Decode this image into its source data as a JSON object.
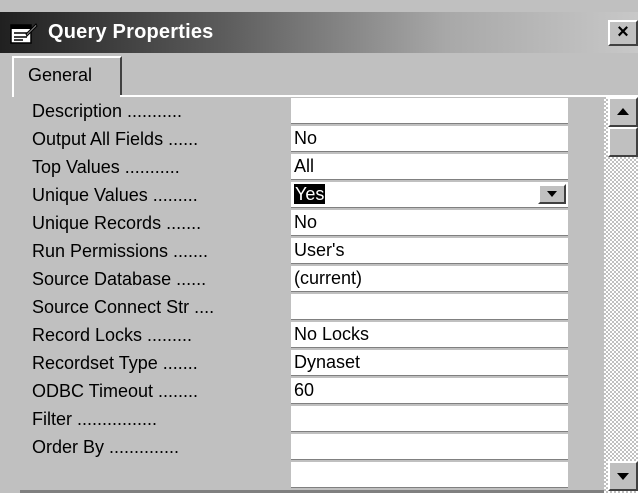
{
  "window": {
    "title": "Query Properties",
    "close_glyph": "×",
    "icon": "properties-sheet-icon"
  },
  "tabs": [
    {
      "label": "General",
      "selected": true
    }
  ],
  "properties": [
    {
      "label": "Description ...........",
      "value": ""
    },
    {
      "label": "Output All Fields ......",
      "value": "No"
    },
    {
      "label": "Top Values ...........",
      "value": "All"
    },
    {
      "label": "Unique Values .........",
      "value": "Yes",
      "dropdown": true,
      "selected": true
    },
    {
      "label": "Unique Records .......",
      "value": "No"
    },
    {
      "label": "Run Permissions .......",
      "value": "User's"
    },
    {
      "label": "Source Database ......",
      "value": "(current)"
    },
    {
      "label": "Source Connect Str ....",
      "value": ""
    },
    {
      "label": "Record Locks .........",
      "value": "No Locks"
    },
    {
      "label": "Recordset Type .......",
      "value": "Dynaset"
    },
    {
      "label": "ODBC Timeout ........",
      "value": "60"
    },
    {
      "label": "Filter ................",
      "value": ""
    },
    {
      "label": "Order By ..............",
      "value": ""
    },
    {
      "label": "",
      "value": ""
    }
  ],
  "scrollbar": {
    "up_icon": "scroll-up-arrow-icon",
    "down_icon": "scroll-down-arrow-icon"
  },
  "colors": {
    "titlebar_start": "#202020",
    "titlebar_end": "#c8c8c8",
    "face": "#c0c0c0",
    "field": "#ffffff",
    "selection": "#000000"
  }
}
